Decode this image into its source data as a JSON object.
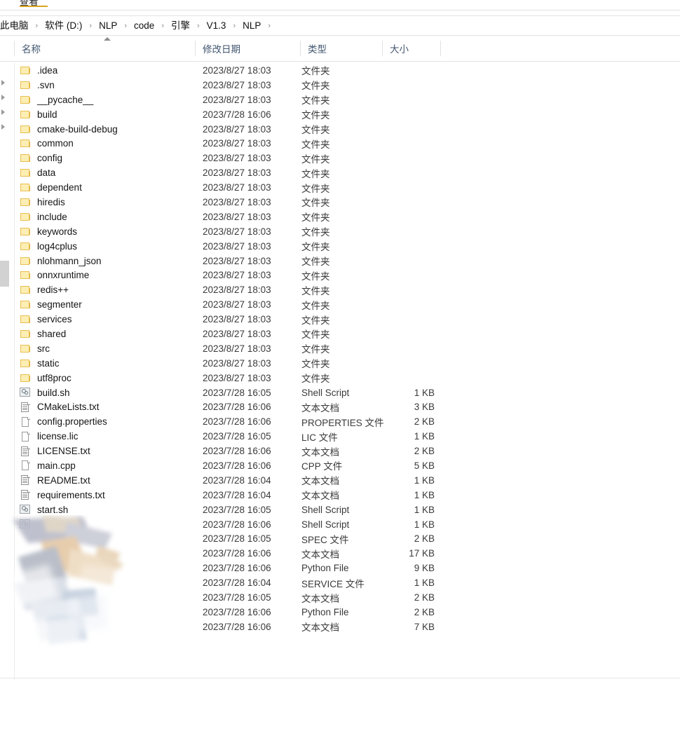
{
  "ribbon": {
    "tab_label": "查看"
  },
  "breadcrumb": {
    "separator": "›",
    "items": [
      {
        "label": "此电脑"
      },
      {
        "label": "软件 (D:)"
      },
      {
        "label": "NLP"
      },
      {
        "label": "code"
      },
      {
        "label": "引擎"
      },
      {
        "label": "V1.3"
      },
      {
        "label": "NLP"
      }
    ]
  },
  "columns": [
    {
      "label": "名称",
      "key": "name"
    },
    {
      "label": "修改日期",
      "key": "date"
    },
    {
      "label": "类型",
      "key": "type"
    },
    {
      "label": "大小",
      "key": "size"
    }
  ],
  "sort": {
    "column": "名称",
    "direction": "ascending"
  },
  "colors": {
    "folder_fill": "#fdeeb4",
    "folder_border": "#e9bf52",
    "header_text": "#42566f",
    "row_text": "#1d1d1d",
    "accent_underline": "#d9a520"
  },
  "rows": [
    {
      "icon": "folder-icon",
      "name": ".idea",
      "date": "2023/8/27 18:03",
      "type": "文件夹",
      "size": ""
    },
    {
      "icon": "folder-icon",
      "name": ".svn",
      "date": "2023/8/27 18:03",
      "type": "文件夹",
      "size": ""
    },
    {
      "icon": "folder-icon",
      "name": "__pycache__",
      "date": "2023/8/27 18:03",
      "type": "文件夹",
      "size": ""
    },
    {
      "icon": "folder-icon",
      "name": "build",
      "date": "2023/7/28 16:06",
      "type": "文件夹",
      "size": ""
    },
    {
      "icon": "folder-icon",
      "name": "cmake-build-debug",
      "date": "2023/8/27 18:03",
      "type": "文件夹",
      "size": ""
    },
    {
      "icon": "folder-icon",
      "name": "common",
      "date": "2023/8/27 18:03",
      "type": "文件夹",
      "size": ""
    },
    {
      "icon": "folder-icon",
      "name": "config",
      "date": "2023/8/27 18:03",
      "type": "文件夹",
      "size": ""
    },
    {
      "icon": "folder-icon",
      "name": "data",
      "date": "2023/8/27 18:03",
      "type": "文件夹",
      "size": ""
    },
    {
      "icon": "folder-icon",
      "name": "dependent",
      "date": "2023/8/27 18:03",
      "type": "文件夹",
      "size": ""
    },
    {
      "icon": "folder-icon",
      "name": "hiredis",
      "date": "2023/8/27 18:03",
      "type": "文件夹",
      "size": ""
    },
    {
      "icon": "folder-icon",
      "name": "include",
      "date": "2023/8/27 18:03",
      "type": "文件夹",
      "size": ""
    },
    {
      "icon": "folder-icon",
      "name": "keywords",
      "date": "2023/8/27 18:03",
      "type": "文件夹",
      "size": ""
    },
    {
      "icon": "folder-icon",
      "name": "log4cplus",
      "date": "2023/8/27 18:03",
      "type": "文件夹",
      "size": ""
    },
    {
      "icon": "folder-icon",
      "name": "nlohmann_json",
      "date": "2023/8/27 18:03",
      "type": "文件夹",
      "size": ""
    },
    {
      "icon": "folder-icon",
      "name": "onnxruntime",
      "date": "2023/8/27 18:03",
      "type": "文件夹",
      "size": ""
    },
    {
      "icon": "folder-icon",
      "name": "redis++",
      "date": "2023/8/27 18:03",
      "type": "文件夹",
      "size": ""
    },
    {
      "icon": "folder-icon",
      "name": "segmenter",
      "date": "2023/8/27 18:03",
      "type": "文件夹",
      "size": ""
    },
    {
      "icon": "folder-icon",
      "name": "services",
      "date": "2023/8/27 18:03",
      "type": "文件夹",
      "size": ""
    },
    {
      "icon": "folder-icon",
      "name": "shared",
      "date": "2023/8/27 18:03",
      "type": "文件夹",
      "size": ""
    },
    {
      "icon": "folder-icon",
      "name": "src",
      "date": "2023/8/27 18:03",
      "type": "文件夹",
      "size": ""
    },
    {
      "icon": "folder-icon",
      "name": "static",
      "date": "2023/8/27 18:03",
      "type": "文件夹",
      "size": ""
    },
    {
      "icon": "folder-icon",
      "name": "utf8proc",
      "date": "2023/8/27 18:03",
      "type": "文件夹",
      "size": ""
    },
    {
      "icon": "shell-script-icon",
      "name": "build.sh",
      "date": "2023/7/28 16:05",
      "type": "Shell Script",
      "size": "1 KB"
    },
    {
      "icon": "text-document-icon",
      "name": "CMakeLists.txt",
      "date": "2023/7/28 16:06",
      "type": "文本文档",
      "size": "3 KB"
    },
    {
      "icon": "file-icon",
      "name": "config.properties",
      "date": "2023/7/28 16:06",
      "type": "PROPERTIES 文件",
      "size": "2 KB"
    },
    {
      "icon": "file-icon",
      "name": "license.lic",
      "date": "2023/7/28 16:05",
      "type": "LIC 文件",
      "size": "1 KB"
    },
    {
      "icon": "text-document-icon",
      "name": "LICENSE.txt",
      "date": "2023/7/28 16:06",
      "type": "文本文档",
      "size": "2 KB"
    },
    {
      "icon": "file-icon",
      "name": "main.cpp",
      "date": "2023/7/28 16:06",
      "type": "CPP 文件",
      "size": "5 KB"
    },
    {
      "icon": "text-document-icon",
      "name": "README.txt",
      "date": "2023/7/28 16:04",
      "type": "文本文档",
      "size": "1 KB"
    },
    {
      "icon": "text-document-icon",
      "name": "requirements.txt",
      "date": "2023/7/28 16:04",
      "type": "文本文档",
      "size": "1 KB"
    },
    {
      "icon": "shell-script-icon",
      "name": "start.sh",
      "date": "2023/7/28 16:05",
      "type": "Shell Script",
      "size": "1 KB"
    },
    {
      "icon": "shell-script-icon",
      "name": "",
      "date": "2023/7/28 16:06",
      "type": "Shell Script",
      "size": "1 KB"
    },
    {
      "icon": "",
      "name": "",
      "date": "2023/7/28 16:05",
      "type": "SPEC 文件",
      "size": "2 KB"
    },
    {
      "icon": "",
      "name": "",
      "date": "2023/7/28 16:06",
      "type": "文本文档",
      "size": "17 KB"
    },
    {
      "icon": "",
      "name": "",
      "date": "2023/7/28 16:06",
      "type": "Python File",
      "size": "9 KB"
    },
    {
      "icon": "",
      "name": "",
      "date": "2023/7/28 16:04",
      "type": "SERVICE 文件",
      "size": "1 KB"
    },
    {
      "icon": "",
      "name": "",
      "date": "2023/7/28 16:05",
      "type": "文本文档",
      "size": "2 KB"
    },
    {
      "icon": "",
      "name": "",
      "date": "2023/7/28 16:06",
      "type": "Python File",
      "size": "2 KB"
    },
    {
      "icon": "",
      "name": "",
      "date": "2023/7/28 16:06",
      "type": "文本文档",
      "size": "7 KB"
    }
  ]
}
